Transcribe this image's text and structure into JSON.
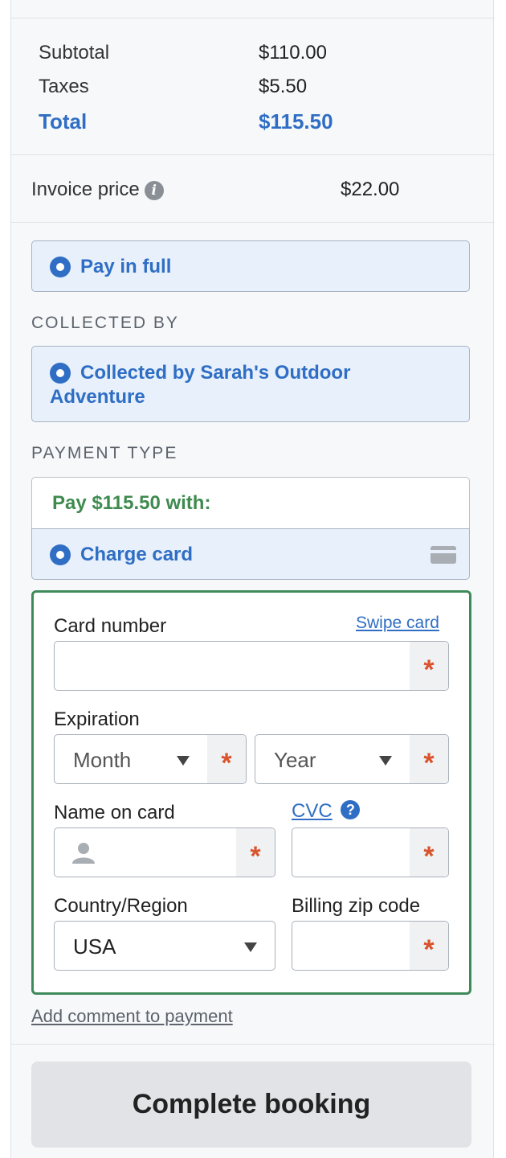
{
  "summary": {
    "subtotal_label": "Subtotal",
    "subtotal_value": "$110.00",
    "taxes_label": "Taxes",
    "taxes_value": "$5.50",
    "total_label": "Total",
    "total_value": "$115.50"
  },
  "invoice": {
    "label": "Invoice price",
    "info_glyph": "i",
    "value": "$22.00"
  },
  "payment_option": {
    "label": "Pay in full"
  },
  "collected_by": {
    "section_label": "COLLECTED BY",
    "option_line1": "Collected by Sarah's Outdoor",
    "option_line2": "Adventure"
  },
  "payment_type": {
    "section_label": "PAYMENT TYPE",
    "pay_with": "Pay $115.50 with:",
    "charge_card": "Charge card"
  },
  "card_form": {
    "card_number_label": "Card number",
    "swipe_link": "Swipe card",
    "required_mark": "*",
    "expiration_label": "Expiration",
    "month_placeholder": "Month",
    "year_placeholder": "Year",
    "name_label": "Name on card",
    "cvc_label": "CVC",
    "help_glyph": "?",
    "country_label": "Country/Region",
    "country_value": "USA",
    "zip_label": "Billing zip code"
  },
  "comment_link": "Add comment to payment",
  "complete_button": "Complete booking",
  "colors": {
    "accent": "#2f6ec4",
    "green": "#3f8a4f",
    "required": "#d9532c"
  },
  "icons": {
    "info": "info-icon",
    "card": "credit-card-icon",
    "person": "person-icon",
    "help": "question-icon",
    "caret": "chevron-down-icon"
  }
}
